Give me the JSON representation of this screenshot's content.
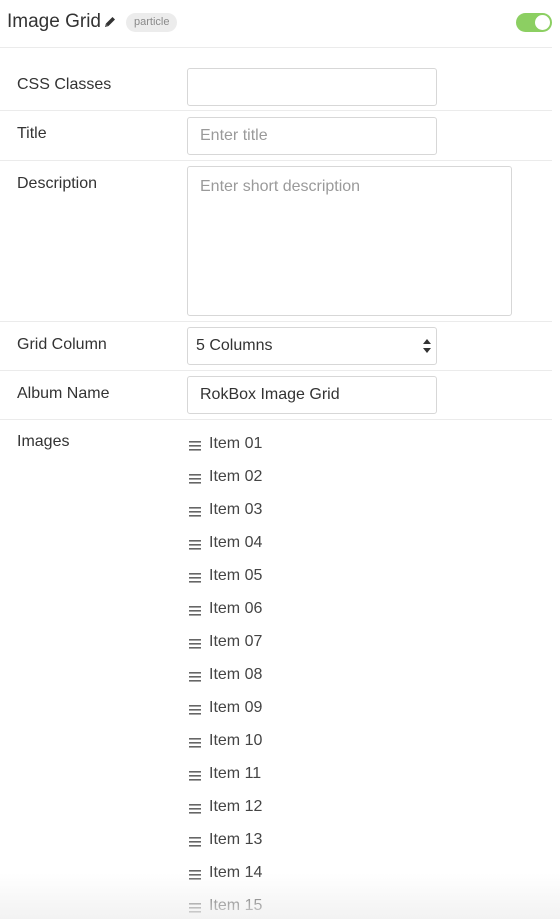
{
  "header": {
    "title": "Image Grid",
    "badge": "particle",
    "toggle_on": true,
    "toggle_color": "#8ccf62"
  },
  "fields": {
    "css_classes": {
      "label": "CSS Classes",
      "value": ""
    },
    "title": {
      "label": "Title",
      "value": "",
      "placeholder": "Enter title"
    },
    "description": {
      "label": "Description",
      "value": "",
      "placeholder": "Enter short description"
    },
    "grid_column": {
      "label": "Grid Column",
      "value": "5 Columns"
    },
    "album_name": {
      "label": "Album Name",
      "value": "RokBox Image Grid"
    }
  },
  "images": {
    "label": "Images",
    "items": [
      {
        "label": "Item 01"
      },
      {
        "label": "Item 02"
      },
      {
        "label": "Item 03"
      },
      {
        "label": "Item 04"
      },
      {
        "label": "Item 05"
      },
      {
        "label": "Item 06"
      },
      {
        "label": "Item 07"
      },
      {
        "label": "Item 08"
      },
      {
        "label": "Item 09"
      },
      {
        "label": "Item 10"
      },
      {
        "label": "Item 11"
      },
      {
        "label": "Item 12"
      },
      {
        "label": "Item 13"
      },
      {
        "label": "Item 14"
      },
      {
        "label": "Item 15"
      }
    ]
  },
  "icons": {
    "edit": "pencil-icon",
    "drag": "drag-handle-icon",
    "select_arrows": "select-arrows-icon"
  }
}
